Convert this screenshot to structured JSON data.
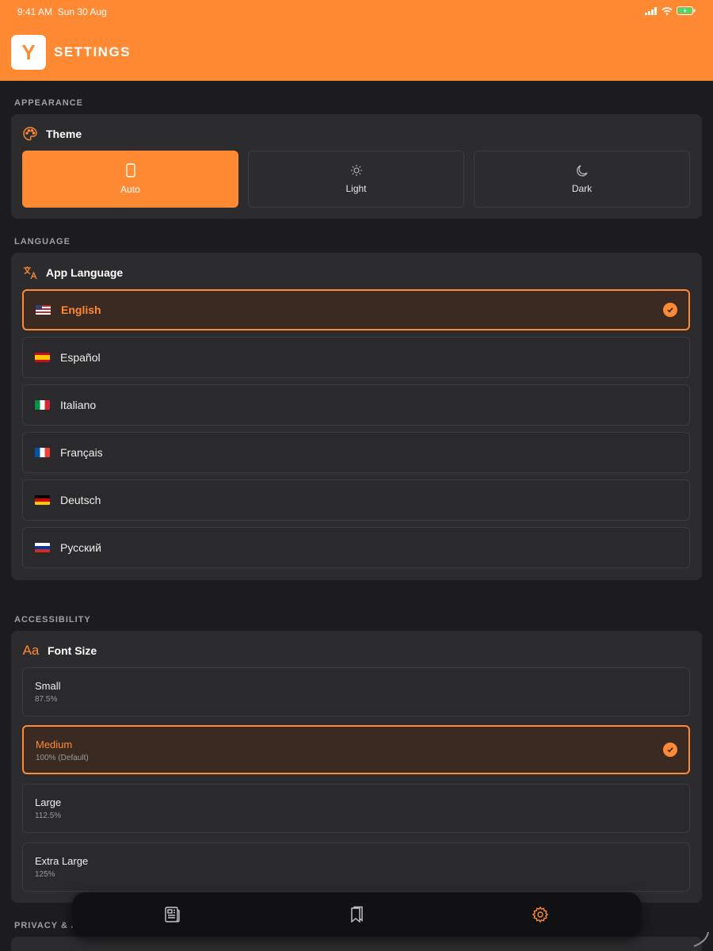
{
  "status": {
    "time": "9:41 AM",
    "date": "Sun 30 Aug"
  },
  "header": {
    "logo_letter": "Y",
    "title": "SETTINGS"
  },
  "appearance": {
    "section": "APPEARANCE",
    "heading": "Theme",
    "options": [
      {
        "label": "Auto",
        "icon": "phone-icon",
        "selected": true
      },
      {
        "label": "Light",
        "icon": "sun-icon",
        "selected": false
      },
      {
        "label": "Dark",
        "icon": "moon-icon",
        "selected": false
      }
    ]
  },
  "language": {
    "section": "LANGUAGE",
    "heading": "App Language",
    "options": [
      {
        "label": "English",
        "flag": "us-flag",
        "selected": true
      },
      {
        "label": "Español",
        "flag": "es-flag",
        "selected": false
      },
      {
        "label": "Italiano",
        "flag": "it-flag",
        "selected": false
      },
      {
        "label": "Français",
        "flag": "fr-flag",
        "selected": false
      },
      {
        "label": "Deutsch",
        "flag": "de-flag",
        "selected": false
      },
      {
        "label": "Русский",
        "flag": "ru-flag",
        "selected": false
      }
    ]
  },
  "accessibility": {
    "section": "ACCESSIBILITY",
    "heading_icon_text": "Aa",
    "heading": "Font Size",
    "options": [
      {
        "label": "Small",
        "value": "87.5%",
        "selected": false
      },
      {
        "label": "Medium",
        "value": "100% (Default)",
        "selected": true
      },
      {
        "label": "Large",
        "value": "112.5%",
        "selected": false
      },
      {
        "label": "Extra Large",
        "value": "125%",
        "selected": false
      }
    ]
  },
  "privacy": {
    "section": "PRIVACY & A"
  },
  "tabbar": {
    "items": [
      "news-icon",
      "bookmarks-icon",
      "settings-icon"
    ],
    "active": "settings-icon"
  },
  "colors": {
    "accent": "#ff8a33",
    "background": "#1c1c1e",
    "card": "#2c2c2e"
  }
}
